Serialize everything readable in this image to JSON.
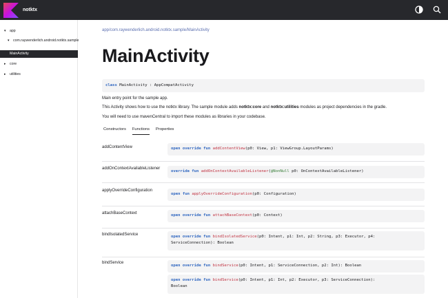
{
  "app": {
    "name": "notktx"
  },
  "header": {
    "theme_icon": "theme-toggle-icon",
    "search_icon": "search-icon"
  },
  "sidebar": {
    "items": [
      {
        "label": "app",
        "toggle": "▾"
      },
      {
        "label": "com.raywenderlich.android.notktx.sample",
        "toggle": "▾"
      },
      {
        "label": "MainActivity",
        "toggle": ""
      },
      {
        "label": "core",
        "toggle": "▸"
      },
      {
        "label": "utilities",
        "toggle": "▸"
      }
    ]
  },
  "main": {
    "breadcrumb": "app/com.raywenderlich.android.notktx.sample/MainActivity",
    "title": "MainActivity",
    "declaration": {
      "kw": "class",
      "rest": "MainActivity : AppCompatActivity"
    },
    "desc1": "Main entry point for the sample app.",
    "desc2": {
      "a": "This Activity shows how to use the notktx library. The sample module adds ",
      "b": "notktx:core",
      "c": " and ",
      "d": "notktx:utilities",
      "e": " modules as project dependencies in the gradle."
    },
    "desc3": "You will need to use mavenCentral to import these modules as libraries in your codebase.",
    "tabs": [
      {
        "label": "Constructors"
      },
      {
        "label": "Functions"
      },
      {
        "label": "Properties"
      }
    ],
    "functions": [
      {
        "name": "addContentView",
        "sig": {
          "kw": "open override fun",
          "fn": "addContentView",
          "args": "(p0: View, p1: ViewGroup.LayoutParams)"
        }
      },
      {
        "name": "addOnContextAvailableListener",
        "sig": {
          "kw": "override fun",
          "fn": "addOnContextAvailableListener",
          "open": "(",
          "ann": "@NonNull",
          "args": " p0: OnContextAvailableListener)"
        }
      },
      {
        "name": "applyOverrideConfiguration",
        "sig": {
          "kw": "open fun",
          "fn": "applyOverrideConfiguration",
          "args": "(p0: Configuration)"
        }
      },
      {
        "name": "attachBaseContext",
        "sig": {
          "kw": "open override fun",
          "fn": "attachBaseContext",
          "args": "(p0: Context)"
        }
      },
      {
        "name": "bindIsolatedService",
        "sig": {
          "kw": "open override fun",
          "fn": "bindIsolatedService",
          "args": "(p0: Intent, p1: Int, p2: String, p3: Executor, p4:",
          "args2": "ServiceConnection): Boolean"
        }
      },
      {
        "name": "bindService",
        "sig": {
          "kw": "open override fun",
          "fn": "bindService",
          "args": "(p0: Intent, p1: ServiceConnection, p2: Int): Boolean"
        },
        "sig2": {
          "kw": "open override fun",
          "fn": "bindService",
          "args": "(p0: Intent, p1: Int, p2: Executor, p3: ServiceConnection):",
          "args2": "Boolean"
        }
      }
    ]
  },
  "colors": {
    "header_bg": "#27282c",
    "keyword": "#2f66c0",
    "function": "#c0303f",
    "annotation": "#3a7f3a",
    "link": "#5b6fb0"
  }
}
